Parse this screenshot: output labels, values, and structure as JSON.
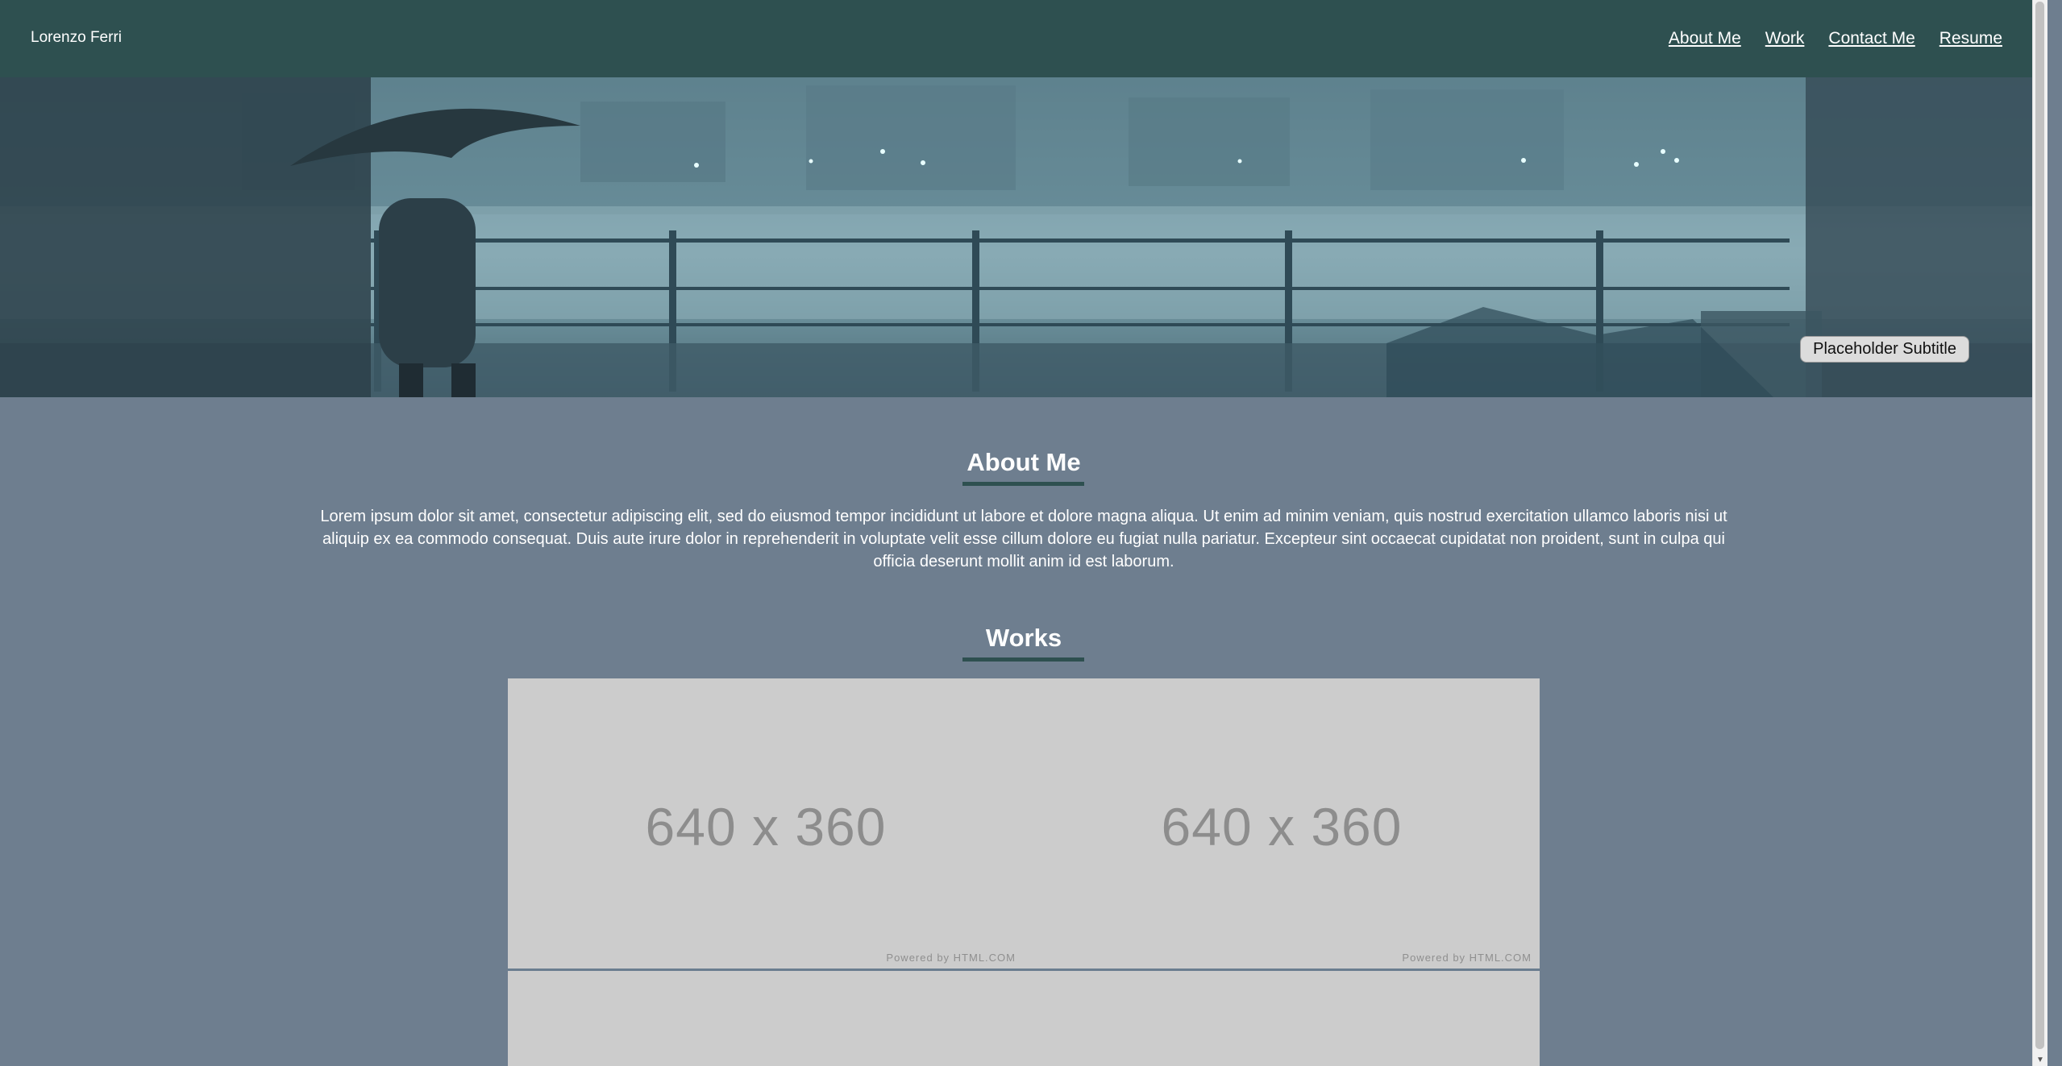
{
  "header": {
    "brand": "Lorenzo Ferri",
    "nav": [
      "About Me",
      "Work",
      "Contact Me",
      "Resume"
    ]
  },
  "hero": {
    "subtitle": "Placeholder Subtitle"
  },
  "about": {
    "title": "About Me",
    "body": "Lorem ipsum dolor sit amet, consectetur adipiscing elit, sed do eiusmod tempor incididunt ut labore et dolore magna aliqua. Ut enim ad minim veniam, quis nostrud exercitation ullamco laboris nisi ut aliquip ex ea commodo consequat. Duis aute irure dolor in reprehenderit in voluptate velit esse cillum dolore eu fugiat nulla pariatur. Excepteur sint occaecat cupidatat non proident, sunt in culpa qui officia deserunt mollit anim id est laborum."
  },
  "works": {
    "title": "Works",
    "items": [
      {
        "placeholder": "640 x 360",
        "powered": "Powered by HTML.COM"
      },
      {
        "placeholder": "640 x 360",
        "powered": "Powered by HTML.COM"
      }
    ]
  },
  "colors": {
    "header": "#2e5050",
    "body": "#6e7e8f",
    "placeholder": "#cccccc"
  }
}
